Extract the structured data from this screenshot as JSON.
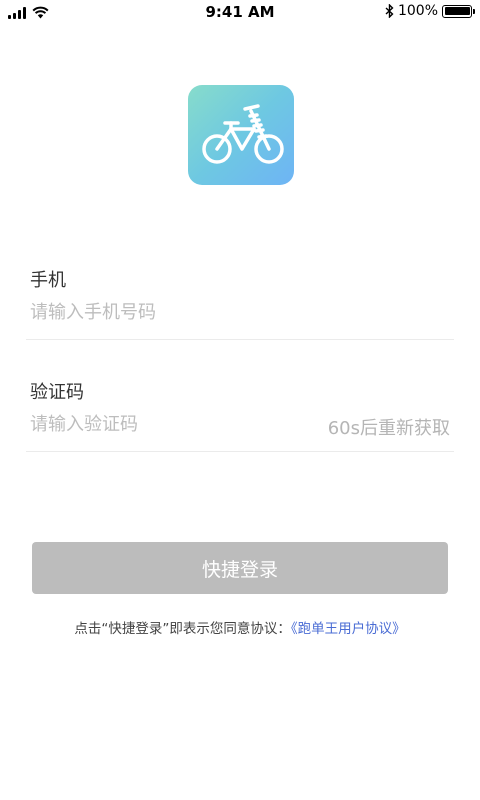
{
  "status_bar": {
    "time": "9:41 AM",
    "battery_text": "100%",
    "battery_level": 1.0,
    "icons": [
      "signal-icon",
      "wifi-icon",
      "bluetooth-icon",
      "battery-icon"
    ]
  },
  "logo": {
    "icon": "bicycle-icon",
    "colors": [
      "#87dccb",
      "#6eb4f5"
    ]
  },
  "phone": {
    "label": "手机",
    "placeholder": "请输入手机号码",
    "value": ""
  },
  "code": {
    "label": "验证码",
    "placeholder": "请输入验证码",
    "value": "",
    "resend_label": "60s后重新获取"
  },
  "login_button": {
    "label": "快捷登录",
    "color": "#bcbcbc"
  },
  "agreement": {
    "prefix": "点击“快捷登录”即表示您同意协议：",
    "link": "《跑单王用户协议》",
    "link_color": "#4a6cd4"
  }
}
